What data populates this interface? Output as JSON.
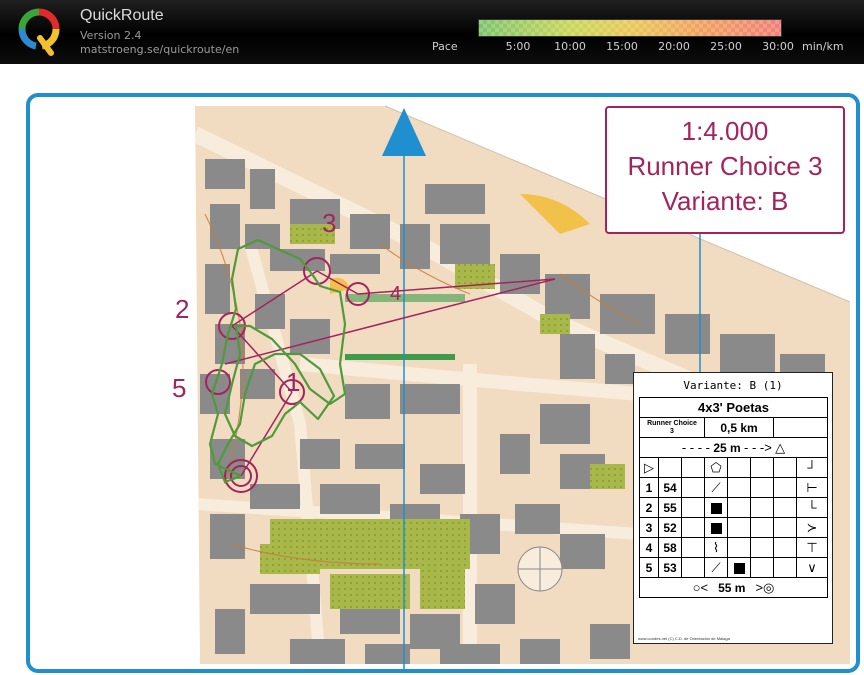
{
  "header": {
    "app_name": "QuickRoute",
    "version": "Version 2.4",
    "url": "matstroeng.se/quickroute/en",
    "pace_label": "Pace",
    "pace_ticks": [
      "5:00",
      "10:00",
      "15:00",
      "20:00",
      "25:00",
      "30:00"
    ],
    "pace_unit": "min/km",
    "pace_colors": [
      "#7fc46c",
      "#c8d65a",
      "#e8c85a",
      "#f0a060",
      "#f08078"
    ]
  },
  "map": {
    "north_arrow_color": "#1f8fcf",
    "route_color": "#4f9a3a",
    "course_color": "#a3245c",
    "control_numbers": [
      "1",
      "2",
      "3",
      "4",
      "5"
    ],
    "title_box": {
      "scale": "1:4.000",
      "line2": "Runner Choice 3",
      "line3": "Variante: B"
    }
  },
  "description_sheet": {
    "variant": "Variante: B (1)",
    "event": "4x3' Poetas",
    "course_name": "Runner Choice",
    "course_number": "3",
    "length": "0,5 km",
    "start_distance": "25 m",
    "controls": [
      {
        "number": "1",
        "code": "54"
      },
      {
        "number": "2",
        "code": "55"
      },
      {
        "number": "3",
        "code": "52"
      },
      {
        "number": "4",
        "code": "58"
      },
      {
        "number": "5",
        "code": "53"
      }
    ],
    "finish_distance": "55 m",
    "footer": "www.condes.net  (C) C.D. de Orientación de Málaga"
  }
}
